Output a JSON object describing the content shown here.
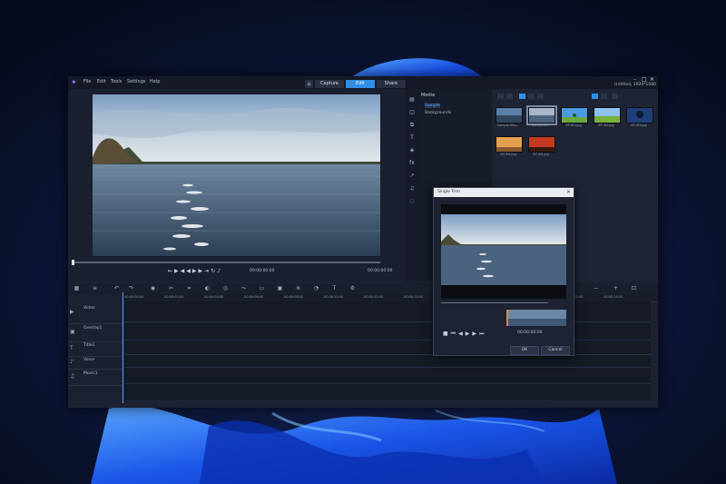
{
  "menubar": {
    "items": [
      "File",
      "Edit",
      "Tools",
      "Settings",
      "Help"
    ],
    "tabs": [
      "Capture",
      "Edit",
      "Share"
    ],
    "active_tab": "Edit",
    "project_name": "Untitled, 1920*1080",
    "home_icon": "home-icon"
  },
  "player": {
    "timecode": "00:00:00:00",
    "duration": "00:00:00:00",
    "controls": [
      "stop-icon",
      "home-icon",
      "prev-frame-icon",
      "play-icon",
      "next-frame-icon",
      "end-icon",
      "repeat-icon",
      "volume-icon"
    ]
  },
  "library": {
    "header": "Media",
    "tree": [
      "Sample",
      "Backgrounds"
    ],
    "selected_tree": "Sample",
    "thumbnails": [
      "Sample-Mov...",
      "Sample-Vi...",
      "SP-I01.jpg",
      "SP-I02.jpg",
      "SP-I03.jpg",
      "SP-I04.jpg",
      "SP-I05.jpg"
    ]
  },
  "timeline": {
    "ruler": [
      "00:00:00:00",
      "00:00:02:00",
      "00:00:04:00",
      "00:00:06:00",
      "00:00:08:00",
      "00:00:10:00",
      "00:00:12:00",
      "00:00:14:00",
      "00:00:16:00",
      "00:00:18:00",
      "00:00:20:00",
      "00:00:22:00",
      "00:00:24:00",
      "00:00:26:00"
    ],
    "tracks": [
      "Video",
      "Overlay1",
      "Title1",
      "Voice",
      "Music1"
    ]
  },
  "dialog": {
    "title": "Single Trim",
    "timecode": "00:00:00:00",
    "ok": "OK",
    "cancel": "Cancel"
  },
  "colors": {
    "accent": "#2f8fe8",
    "app_bg": "#1c2232",
    "wallpaper_swirl": "#1e5cf0"
  }
}
